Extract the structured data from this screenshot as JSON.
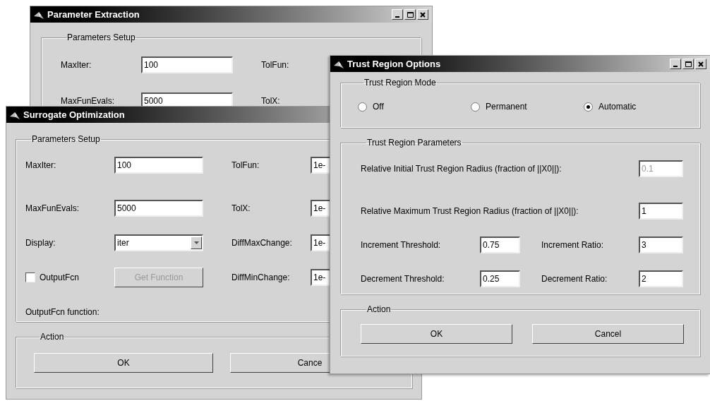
{
  "windows": [
    {
      "title": "Parameter Extraction",
      "window_buttons": true,
      "groups": [
        {
          "title": "Parameters Setup",
          "kind": "form",
          "rows": [
            [
              {
                "kind": "label",
                "text": "MaxIter:"
              },
              {
                "kind": "field",
                "value": "100"
              },
              {
                "kind": "label",
                "text": "TolFun:"
              }
            ],
            [
              {
                "kind": "label",
                "text": "MaxFunEvals:"
              },
              {
                "kind": "field",
                "value": "5000"
              },
              {
                "kind": "label",
                "text": "TolX:"
              }
            ]
          ]
        }
      ]
    },
    {
      "title": "Surrogate Optimization",
      "window_buttons": false,
      "groups": [
        {
          "title": "Parameters Setup",
          "kind": "form",
          "rows": [
            [
              {
                "kind": "label",
                "text": "MaxIter:"
              },
              {
                "kind": "field",
                "value": "100"
              },
              {
                "kind": "label",
                "text": "TolFun:"
              },
              {
                "kind": "field",
                "value": "1e-"
              }
            ],
            [
              {
                "kind": "label",
                "text": "MaxFunEvals:"
              },
              {
                "kind": "field",
                "value": "5000"
              },
              {
                "kind": "label",
                "text": "TolX:"
              },
              {
                "kind": "field",
                "value": "1e-"
              }
            ],
            [
              {
                "kind": "label",
                "text": "Display:"
              },
              {
                "kind": "dropdown",
                "value": "iter"
              },
              {
                "kind": "label",
                "text": "DiffMaxChange:"
              },
              {
                "kind": "field",
                "value": "1e-"
              }
            ],
            [
              {
                "kind": "checkbox",
                "text": "OutputFcn",
                "checked": false
              },
              {
                "kind": "button",
                "text": "Get Function",
                "disabled": true
              },
              {
                "kind": "label",
                "text": "DiffMinChange:"
              },
              {
                "kind": "field",
                "value": "1e-"
              }
            ],
            [
              {
                "kind": "label",
                "text": "OutputFcn function:"
              }
            ]
          ]
        },
        {
          "title": "Action",
          "kind": "buttons",
          "buttons": [
            "OK",
            "Cance"
          ]
        }
      ]
    },
    {
      "title": "Trust Region Options",
      "window_buttons": true,
      "groups": [
        {
          "title": "Trust Region Mode",
          "kind": "radios",
          "options": [
            {
              "label": "Off",
              "selected": false
            },
            {
              "label": "Permanent",
              "selected": false
            },
            {
              "label": "Automatic",
              "selected": true
            }
          ]
        },
        {
          "title": "Trust Region Parameters",
          "kind": "form",
          "rows": [
            [
              {
                "kind": "label",
                "text": "Relative Initial Trust Region Radius (fraction of ||X0||):"
              },
              {
                "kind": "field",
                "value": "0.1",
                "disabled": true
              }
            ],
            [
              {
                "kind": "label",
                "text": "Relative Maximum Trust Region Radius (fraction of ||X0||):"
              },
              {
                "kind": "field",
                "value": "1",
                "disabled": false
              }
            ],
            [
              {
                "kind": "label",
                "text": "Increment Threshold:"
              },
              {
                "kind": "field",
                "value": "0.75"
              },
              {
                "kind": "label",
                "text": "Increment Ratio:"
              },
              {
                "kind": "field",
                "value": "3"
              }
            ],
            [
              {
                "kind": "label",
                "text": "Decrement Threshold:"
              },
              {
                "kind": "field",
                "value": "0.25"
              },
              {
                "kind": "label",
                "text": "Decrement Ratio:"
              },
              {
                "kind": "field",
                "value": "2"
              }
            ]
          ]
        },
        {
          "title": "Action",
          "kind": "buttons",
          "buttons": [
            "OK",
            "Cancel"
          ]
        }
      ]
    }
  ]
}
